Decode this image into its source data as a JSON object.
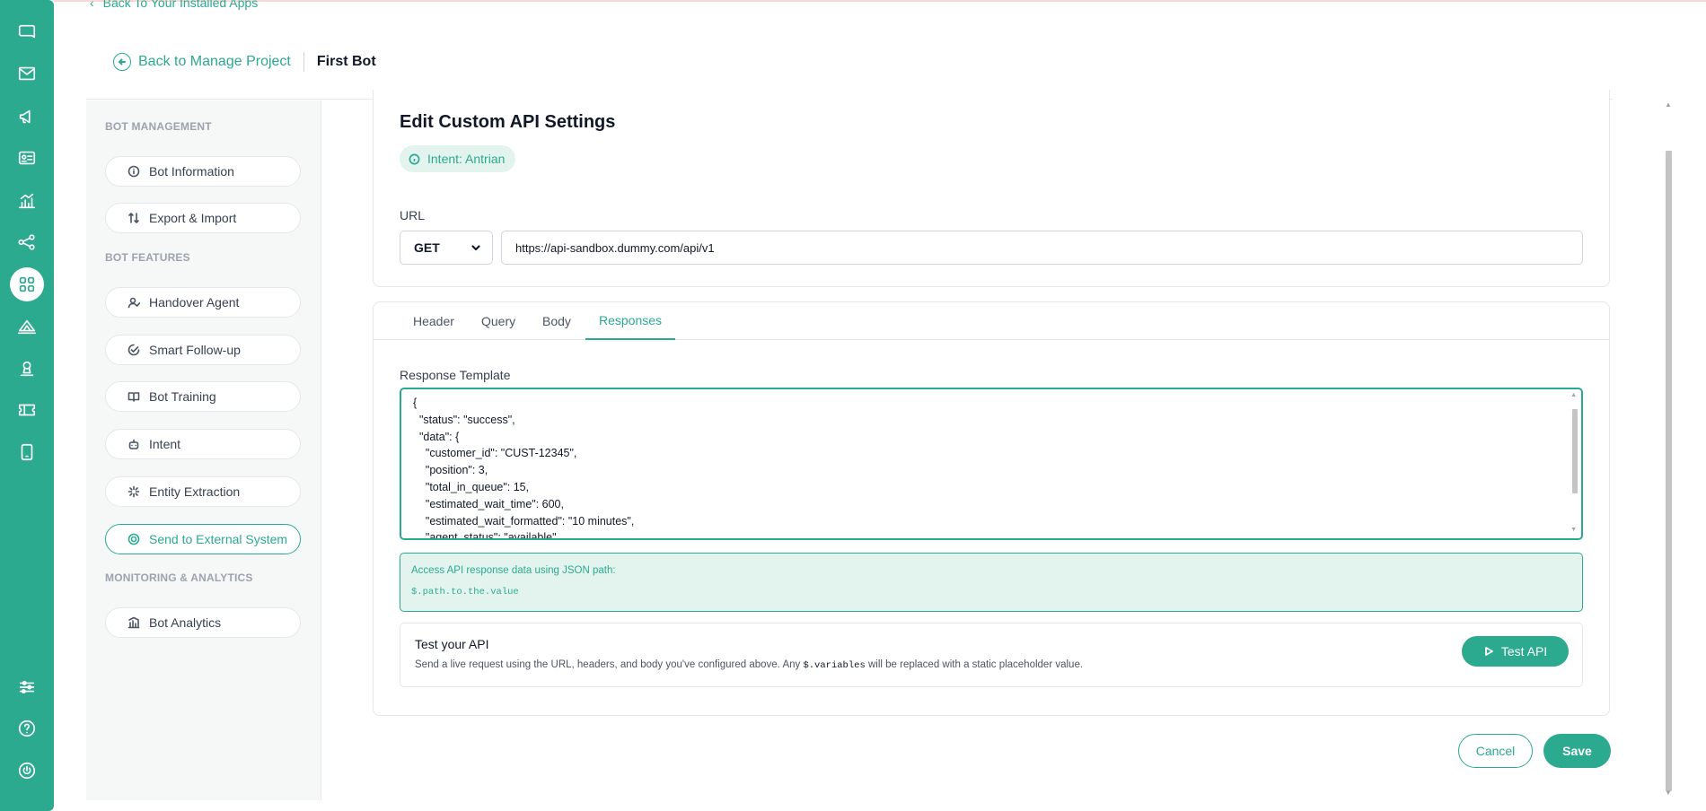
{
  "colors": {
    "accent": "#2baa8f",
    "accent_light": "#e3f4ef",
    "rail": "#2baa8f"
  },
  "rail": {
    "top_icons": [
      "chat-bubble-icon",
      "mail-icon",
      "megaphone-icon",
      "contact-card-icon",
      "bar-chart-icon",
      "share-nodes-icon",
      "apps-grid-icon",
      "broadcast-icon",
      "user-stamp-icon",
      "ticket-icon",
      "tablet-icon"
    ],
    "active_icon": "apps-grid-icon",
    "bottom_icons": [
      "sliders-icon",
      "help-icon",
      "power-icon"
    ]
  },
  "header": {
    "back_installed_apps": "Back To Your Installed Apps",
    "back_manage_project": "Back to Manage Project",
    "bot_name": "First Bot"
  },
  "sidebar": {
    "sections": [
      {
        "title": "BOT MANAGEMENT"
      },
      {
        "title": "BOT FEATURES"
      },
      {
        "title": "MONITORING & ANALYTICS"
      }
    ],
    "items": [
      {
        "label": "Bot Information",
        "icon": "info-icon"
      },
      {
        "label": "Export & Import",
        "icon": "arrows-updown-icon"
      },
      {
        "label": "Handover Agent",
        "icon": "user-check-icon"
      },
      {
        "label": "Smart Follow-up",
        "icon": "message-check-icon"
      },
      {
        "label": "Bot Training",
        "icon": "book-open-icon"
      },
      {
        "label": "Intent",
        "icon": "robot-icon"
      },
      {
        "label": "Entity Extraction",
        "icon": "sparkle-icon"
      },
      {
        "label": "Send to External System",
        "icon": "target-icon",
        "active": true
      },
      {
        "label": "Bot Analytics",
        "icon": "bank-chart-icon"
      }
    ]
  },
  "main": {
    "title": "Edit Custom API Settings",
    "intent_badge": "Intent: Antrian",
    "url_label": "URL",
    "method": "GET",
    "url_value": "https://api-sandbox.dummy.com/api/v1",
    "tabs": [
      {
        "label": "Header"
      },
      {
        "label": "Query"
      },
      {
        "label": "Body"
      },
      {
        "label": "Responses",
        "active": true
      }
    ],
    "response_label": "Response Template",
    "response_template": "{\n  \"status\": \"success\",\n  \"data\": {\n    \"customer_id\": \"CUST-12345\",\n    \"position\": 3,\n    \"total_in_queue\": 15,\n    \"estimated_wait_time\": 600,\n    \"estimated_wait_formatted\": \"10 minutes\",\n    \"agent_status\": \"available\"",
    "hint_title": "Access API response data using JSON path:",
    "hint_code": "$.path.to.the.value",
    "test": {
      "title": "Test your API",
      "desc_before": "Send a live request using the URL, headers, and body you've configured above. Any ",
      "desc_code": "$.variables",
      "desc_after": " will be replaced with a static placeholder value.",
      "button": "Test API"
    },
    "cancel": "Cancel",
    "save": "Save"
  }
}
